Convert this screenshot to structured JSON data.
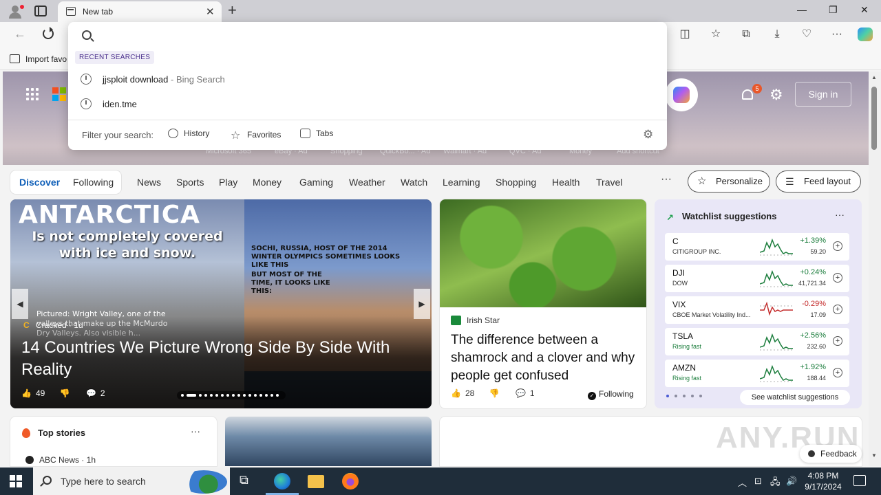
{
  "browser": {
    "tab_title": "New tab",
    "favorites_label": "Import favo"
  },
  "omnibox": {
    "recent_label": "RECENT SEARCHES",
    "recent": [
      {
        "query": "jjsploit download",
        "suffix": " - Bing Search"
      },
      {
        "query": "iden.tme",
        "suffix": ""
      }
    ],
    "filter_label": "Filter your search:",
    "filters": [
      "History",
      "Favorites",
      "Tabs"
    ]
  },
  "hero": {
    "notification_count": "5",
    "signin_label": "Sign in",
    "shortcuts": [
      "Microsoft 365",
      "eBay · Ad",
      "Shopping",
      "QuickBo... · Ad",
      "Walmart · Ad",
      "QVC · Ad",
      "Money",
      "Add shortcut"
    ]
  },
  "feed_nav": {
    "discover": "Discover",
    "following": "Following",
    "links": [
      "News",
      "Sports",
      "Play",
      "Money",
      "Gaming",
      "Weather",
      "Watch",
      "Learning",
      "Shopping",
      "Health",
      "Travel"
    ],
    "more": "···",
    "personalize": "Personalize",
    "feed_layout": "Feed layout"
  },
  "main_card": {
    "image_title": "ANTARCTICA",
    "image_caption": "Is not completely covered with ice and snow.",
    "image_caption_right1": "SOCHI, RUSSIA, HOST OF THE 2014 WINTER OLYMPICS SOMETIMES LOOKS LIKE THIS",
    "image_caption_right2": "BUT MOST OF THE TIME, IT LOOKS LIKE THIS:",
    "image_caption_pictured": "Pictured: Wright Valley, one of the valleys that make up the McMurdo Dry Valleys. Also visible h...",
    "source": "Cracked · 1d",
    "headline": "14 Countries We Picture Wrong Side By Side With Reality",
    "likes": "49",
    "comments": "2"
  },
  "card2": {
    "source": "Irish Star",
    "headline": "The difference between a shamrock and a clover and why people get confused",
    "likes": "28",
    "comments": "1",
    "following": "Following"
  },
  "watchlist": {
    "title": "Watchlist suggestions",
    "more": "···",
    "see_all": "See watchlist suggestions",
    "stocks": [
      {
        "symbol": "C",
        "name": "CITIGROUP INC.",
        "change": "+1.39%",
        "price": "59.20",
        "direction": "up",
        "name_style": "plain"
      },
      {
        "symbol": "DJI",
        "name": "DOW",
        "change": "+0.24%",
        "price": "41,721.34",
        "direction": "up",
        "name_style": "plain"
      },
      {
        "symbol": "VIX",
        "name": "CBOE Market Volatility Ind...",
        "change": "-0.29%",
        "price": "17.09",
        "direction": "down",
        "name_style": "plain"
      },
      {
        "symbol": "TSLA",
        "name": "Rising fast",
        "change": "+2.56%",
        "price": "232.60",
        "direction": "up",
        "name_style": "rising"
      },
      {
        "symbol": "AMZN",
        "name": "Rising fast",
        "change": "+1.92%",
        "price": "188.44",
        "direction": "up",
        "name_style": "rising"
      }
    ]
  },
  "top_stories": {
    "title": "Top stories",
    "more": "···",
    "first_source": "ABC News · 1h"
  },
  "feedback_label": "Feedback",
  "taskbar": {
    "search_placeholder": "Type here to search",
    "time": "4:08 PM",
    "date": "9/17/2024"
  },
  "colors": {
    "accent": "#0f5fb8",
    "stock_up": "#1b7d3c",
    "stock_down": "#c42b2b",
    "taskbar": "#1f2d3a"
  }
}
